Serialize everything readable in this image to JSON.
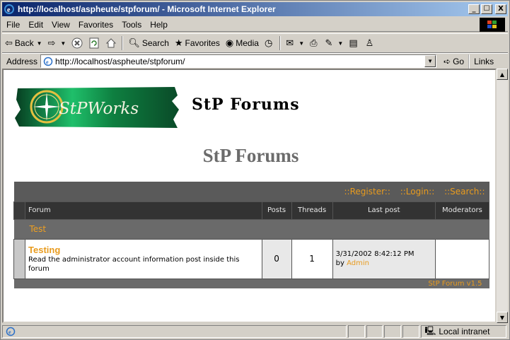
{
  "window": {
    "title": "http://localhost/aspheute/stpforum/ - Microsoft Internet Explorer",
    "min_label": "_",
    "max_label": "☐",
    "close_label": "X"
  },
  "menu": [
    "File",
    "Edit",
    "View",
    "Favorites",
    "Tools",
    "Help"
  ],
  "toolbar": {
    "back": "Back",
    "search": "Search",
    "favorites": "Favorites",
    "media": "Media"
  },
  "address": {
    "label": "Address",
    "url": "http://localhost/aspheute/stpforum/",
    "go": "Go",
    "links": "Links"
  },
  "page": {
    "header_title": "StP Forums",
    "logo_text": "StPWorks",
    "big_title": "StP Forums",
    "nav": [
      "::Register::",
      "::Login::",
      "::Search::"
    ],
    "columns": [
      "Forum",
      "Posts",
      "Threads",
      "Last post",
      "Moderators"
    ],
    "category": "Test",
    "forum_row": {
      "name": "Testing",
      "description": "Read the administrator account information post inside this forum",
      "posts": "0",
      "threads": "1",
      "last_post_date": "3/31/2002 8:42:12 PM",
      "last_post_by": "by",
      "last_post_user": "Admin",
      "moderators": ""
    },
    "footer": "StP Forum v1.5"
  },
  "status": {
    "zone": "Local intranet"
  },
  "colors": {
    "accent_orange": "#e89b1e",
    "table_dark": "#333333",
    "table_mid": "#5a5a5a"
  }
}
